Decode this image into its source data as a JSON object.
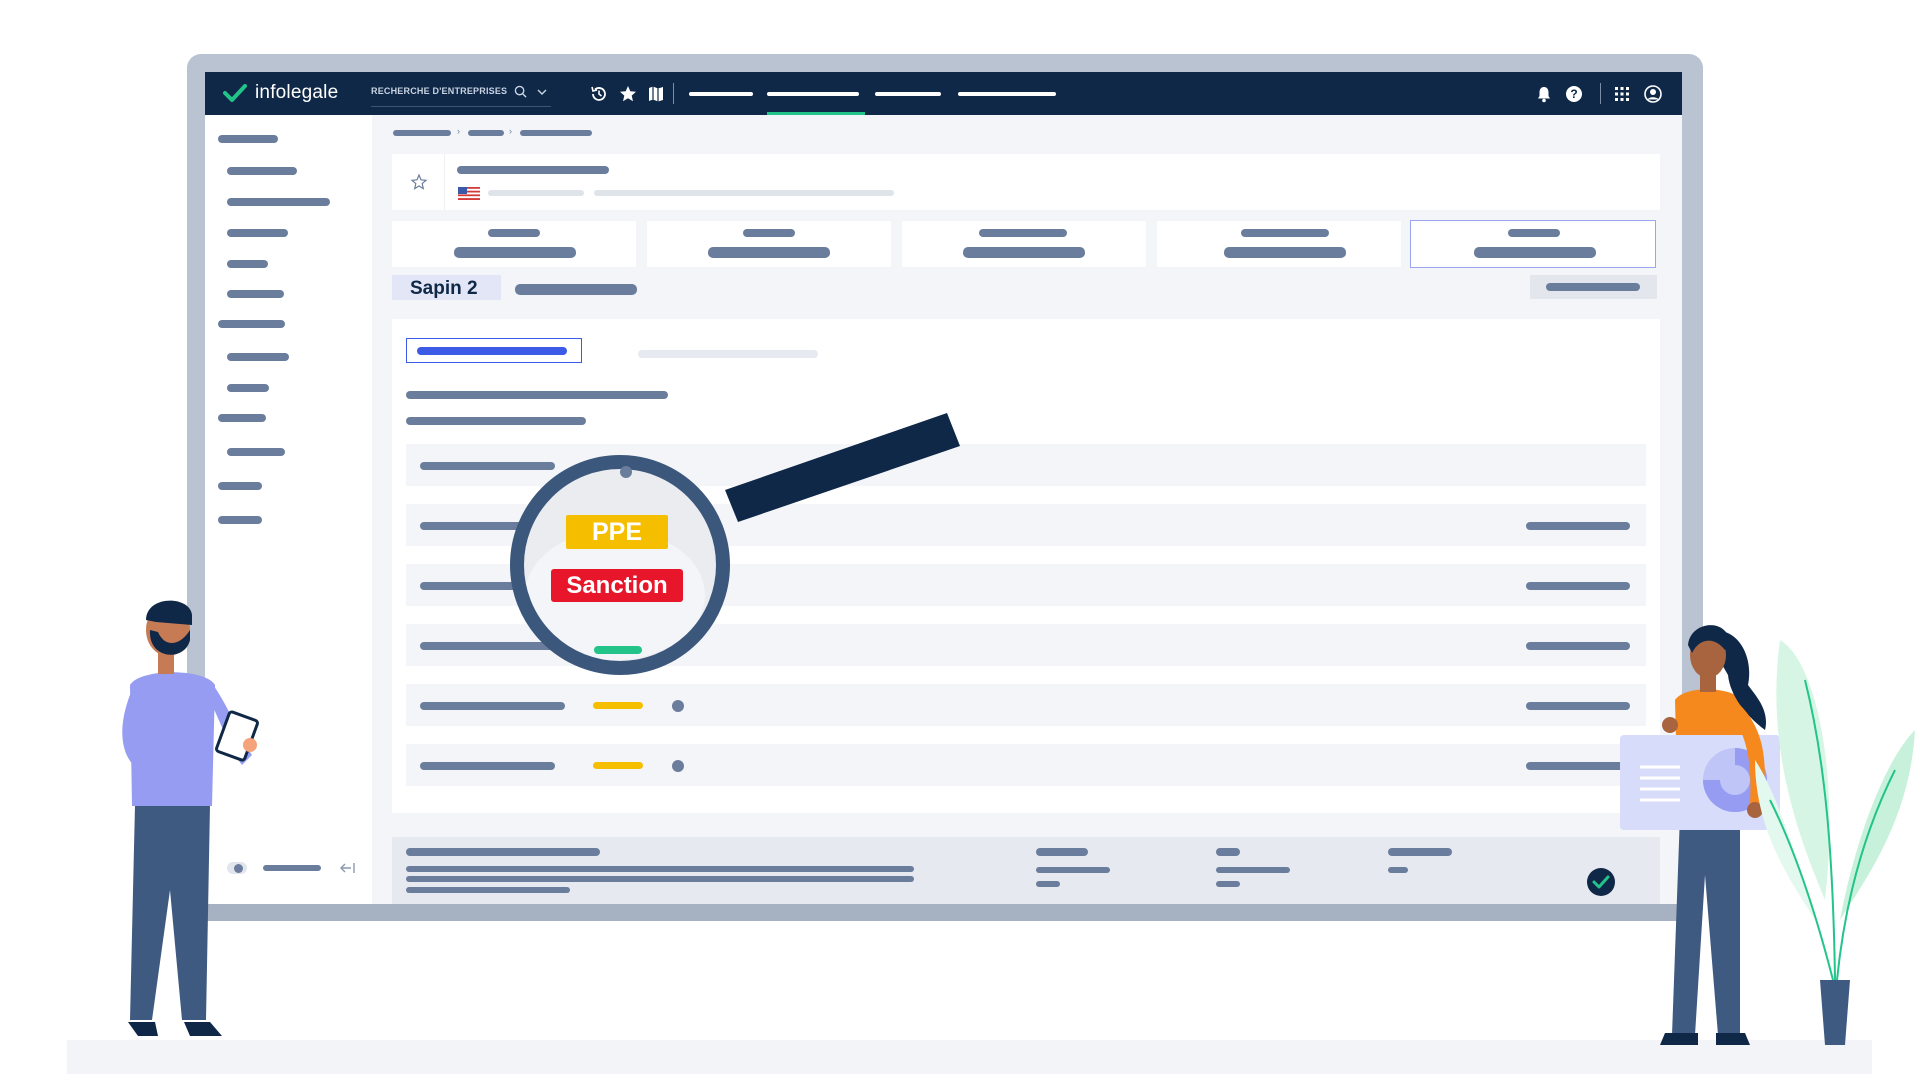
{
  "brand": {
    "name": "infolegale",
    "accent": "#23c489",
    "nav_bg": "#0f2847"
  },
  "header": {
    "search_label": "RECHERCHE D'ENTREPRISES",
    "icons": [
      "history-icon",
      "star-icon",
      "map-icon",
      "bell-icon",
      "help-icon",
      "apps-grid-icon",
      "user-icon"
    ]
  },
  "section": {
    "title": "Sapin 2"
  },
  "badges": {
    "ppe": "PPE",
    "sanction": "Sanction"
  },
  "colors": {
    "ppe": "#f5bf00",
    "sanction": "#e8162a",
    "tab_active": "#3b5ae6",
    "placeholder": "#6b7d9c"
  }
}
